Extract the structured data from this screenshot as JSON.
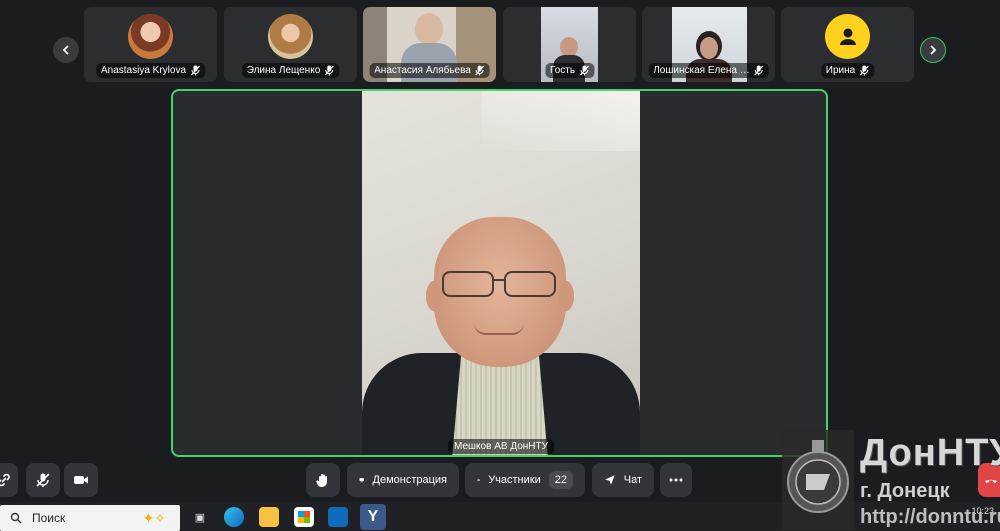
{
  "participants": [
    {
      "name": "Anastasiya Krylova",
      "kind": "avatar-photo",
      "muted": true
    },
    {
      "name": "Элина Лещенко",
      "kind": "avatar-photo",
      "muted": true
    },
    {
      "name": "Анастасия Алябьева",
      "kind": "video",
      "muted": true
    },
    {
      "name": "Гость",
      "kind": "video",
      "muted": true
    },
    {
      "name": "Лошинская Елена …",
      "kind": "video",
      "muted": true
    },
    {
      "name": "Ирина",
      "kind": "avatar-icon",
      "muted": true
    }
  ],
  "speaker": {
    "name": "Мешков АВ ДонНТУ"
  },
  "controls": {
    "demo_label": "Демонстрация",
    "participants_label": "Участники",
    "participants_count": "22",
    "chat_label": "Чат"
  },
  "taskbar": {
    "search_placeholder": "Поиск",
    "clock": "10:23"
  },
  "watermark": {
    "brand": "ДонНТУ",
    "city": "г. Донецк",
    "url": "http://donntu.ru"
  },
  "colors": {
    "accent_green": "#44d36b",
    "tile_bg": "#2c2d31",
    "yellow_avatar": "#ffd21f"
  }
}
